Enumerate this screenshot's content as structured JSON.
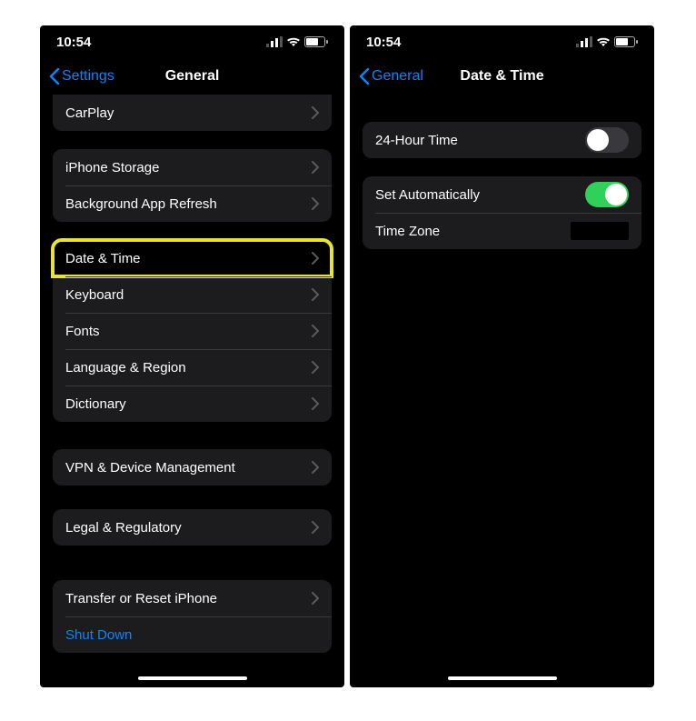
{
  "status": {
    "time": "10:54"
  },
  "left": {
    "back": "Settings",
    "title": "General",
    "groups": [
      {
        "rows": [
          {
            "label": "CarPlay",
            "type": "nav"
          }
        ]
      },
      {
        "rows": [
          {
            "label": "iPhone Storage",
            "type": "nav"
          },
          {
            "label": "Background App Refresh",
            "type": "nav"
          }
        ]
      },
      {
        "rows": [
          {
            "label": "Date & Time",
            "type": "nav",
            "highlight": true
          },
          {
            "label": "Keyboard",
            "type": "nav"
          },
          {
            "label": "Fonts",
            "type": "nav"
          },
          {
            "label": "Language & Region",
            "type": "nav"
          },
          {
            "label": "Dictionary",
            "type": "nav"
          }
        ]
      },
      {
        "rows": [
          {
            "label": "VPN & Device Management",
            "type": "nav"
          }
        ]
      },
      {
        "rows": [
          {
            "label": "Legal & Regulatory",
            "type": "nav"
          }
        ]
      },
      {
        "rows": [
          {
            "label": "Transfer or Reset iPhone",
            "type": "nav"
          },
          {
            "label": "Shut Down",
            "type": "link"
          }
        ]
      }
    ]
  },
  "right": {
    "back": "General",
    "title": "Date & Time",
    "groups": [
      {
        "rows": [
          {
            "label": "24-Hour Time",
            "type": "toggle",
            "value": false
          }
        ]
      },
      {
        "rows": [
          {
            "label": "Set Automatically",
            "type": "toggle",
            "value": true
          },
          {
            "label": "Time Zone",
            "type": "value",
            "value_redacted": true
          }
        ]
      }
    ]
  }
}
